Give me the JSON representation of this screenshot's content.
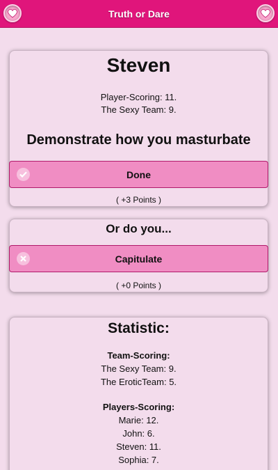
{
  "header": {
    "title": "Truth or Dare",
    "left_icon": "heart-icon",
    "right_icon": "heart-icon"
  },
  "current": {
    "player_name": "Steven",
    "player_scoring": "Player-Scoring: 11.",
    "team_scoring": "The Sexy Team: 9.",
    "dare": "Demonstrate how you masturbate",
    "done_label": "Done",
    "done_points": "( +3 Points )"
  },
  "alternative": {
    "title": "Or do you...",
    "capitulate_label": "Capitulate",
    "capitulate_points": "( +0 Points )"
  },
  "statistic": {
    "title": "Statistic:",
    "team_heading": "Team-Scoring:",
    "teams": [
      "The Sexy Team: 9.",
      "The EroticTeam: 5."
    ],
    "player_heading": "Players-Scoring:",
    "players": [
      "Marie: 12.",
      "John: 6.",
      "Steven: 11.",
      "Sophia: 7."
    ]
  },
  "colors": {
    "header": "#e0157b",
    "background": "#f3dcec",
    "button": "#f08dc3"
  }
}
